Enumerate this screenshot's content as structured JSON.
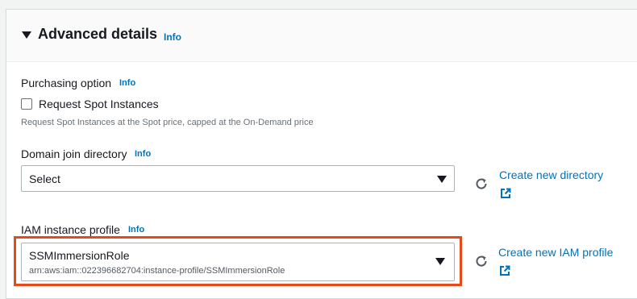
{
  "section": {
    "title": "Advanced details",
    "info": "Info"
  },
  "purchasing": {
    "label": "Purchasing option",
    "info": "Info",
    "checkbox_label": "Request Spot Instances",
    "checkbox_checked": false,
    "description": "Request Spot Instances at the Spot price, capped at the On-Demand price"
  },
  "domain_join": {
    "label": "Domain join directory",
    "info": "Info",
    "selected": "Select",
    "create_link": "Create new directory"
  },
  "iam_profile": {
    "label": "IAM instance profile",
    "info": "Info",
    "selected": "SSMImmersionRole",
    "selected_arn": "arn:aws:iam::022396682704:instance-profile/SSMImmersionRole",
    "create_link": "Create new IAM profile"
  },
  "colors": {
    "link": "#0073bb",
    "highlight": "#e64a19"
  }
}
